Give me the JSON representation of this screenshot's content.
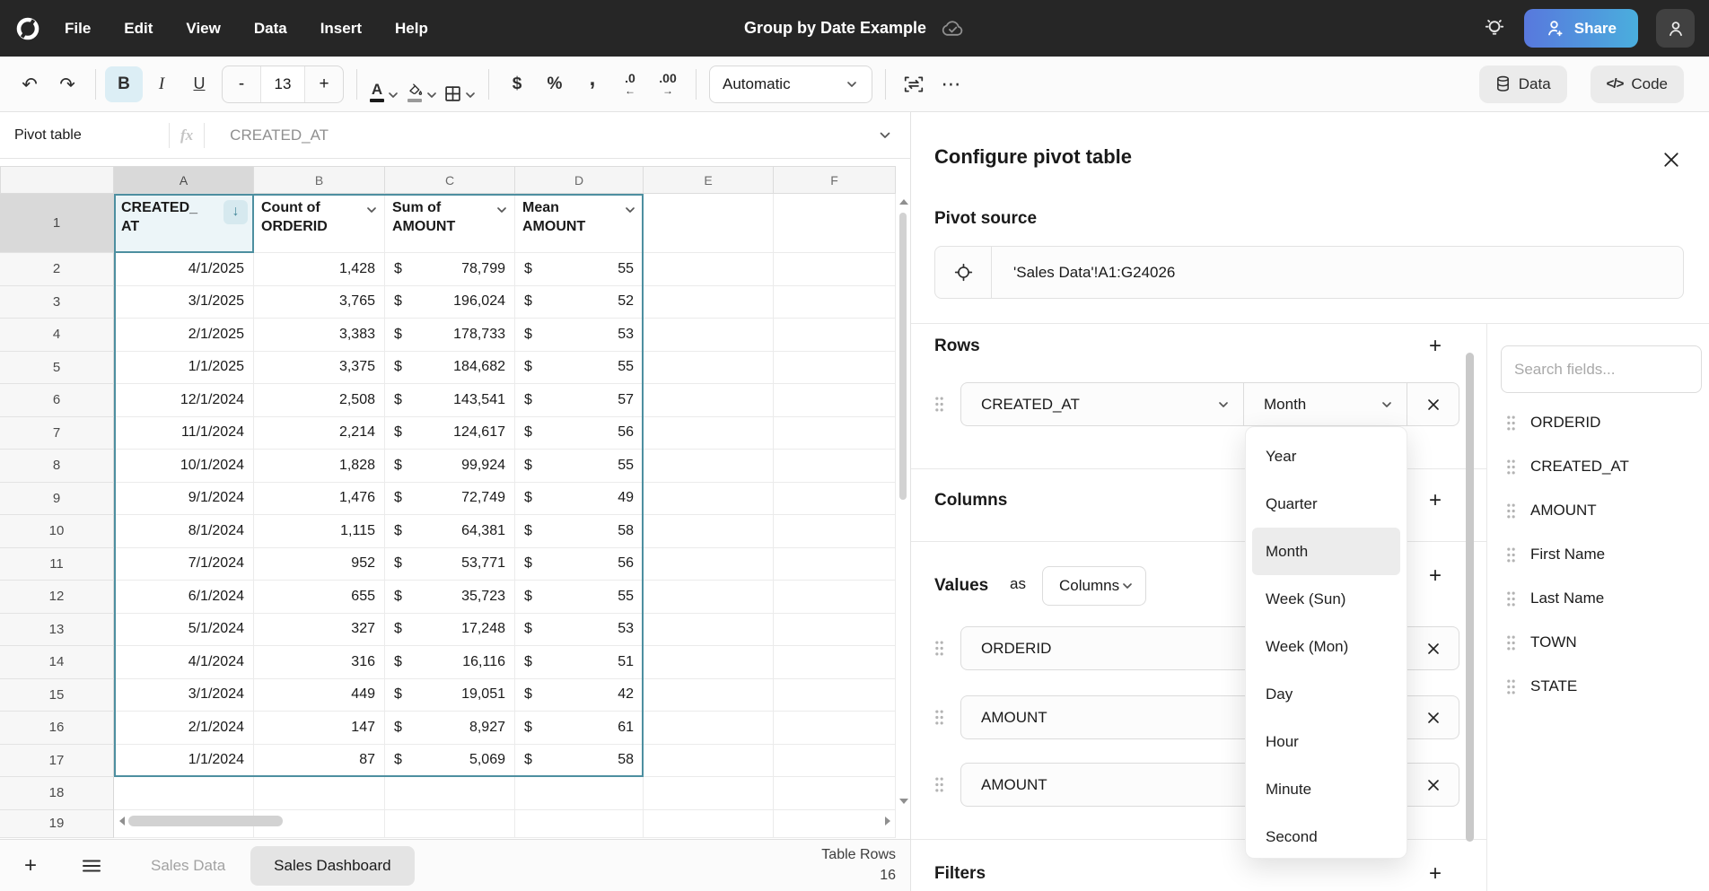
{
  "topbar": {
    "menu": [
      "File",
      "Edit",
      "View",
      "Data",
      "Insert",
      "Help"
    ],
    "title": "Group by Date Example",
    "share_label": "Share"
  },
  "toolbar": {
    "bold": "B",
    "italic": "I",
    "underline": "U",
    "minus": "-",
    "font_size": "13",
    "plus": "+",
    "text_color": "A",
    "currency": "$",
    "percent": "%",
    "comma": ",",
    "dec0": ".0",
    "dec00": ".00",
    "dec_left_arrow": "←",
    "dec_right_arrow": "→",
    "format_select": "Automatic",
    "more": "⋯",
    "data_label": "Data",
    "code_icon": "</>",
    "code_label": "Code",
    "undo": "↶",
    "redo": "↷"
  },
  "formula_bar": {
    "name_box": "Pivot table",
    "fx": "fx",
    "value": "CREATED_AT"
  },
  "grid": {
    "columns": [
      "A",
      "B",
      "C",
      "D",
      "E",
      "F"
    ],
    "row_numbers": [
      "1",
      "2",
      "3",
      "4",
      "5",
      "6",
      "7",
      "8",
      "9",
      "10",
      "11",
      "12",
      "13",
      "14",
      "15",
      "16",
      "17",
      "18",
      "19"
    ],
    "header": {
      "a1": "CREATED_",
      "a2": "AT",
      "b1": "Count of",
      "b2": "ORDERID",
      "c1": "Sum of",
      "c2": "AMOUNT",
      "d1": "Mean",
      "d2": "AMOUNT"
    },
    "sort_arrow": "↓",
    "currency": "$",
    "rows": [
      {
        "date": "4/1/2025",
        "count": "1,428",
        "sum": "78,799",
        "mean": "55"
      },
      {
        "date": "3/1/2025",
        "count": "3,765",
        "sum": "196,024",
        "mean": "52"
      },
      {
        "date": "2/1/2025",
        "count": "3,383",
        "sum": "178,733",
        "mean": "53"
      },
      {
        "date": "1/1/2025",
        "count": "3,375",
        "sum": "184,682",
        "mean": "55"
      },
      {
        "date": "12/1/2024",
        "count": "2,508",
        "sum": "143,541",
        "mean": "57"
      },
      {
        "date": "11/1/2024",
        "count": "2,214",
        "sum": "124,617",
        "mean": "56"
      },
      {
        "date": "10/1/2024",
        "count": "1,828",
        "sum": "99,924",
        "mean": "55"
      },
      {
        "date": "9/1/2024",
        "count": "1,476",
        "sum": "72,749",
        "mean": "49"
      },
      {
        "date": "8/1/2024",
        "count": "1,115",
        "sum": "64,381",
        "mean": "58"
      },
      {
        "date": "7/1/2024",
        "count": "952",
        "sum": "53,771",
        "mean": "56"
      },
      {
        "date": "6/1/2024",
        "count": "655",
        "sum": "35,723",
        "mean": "55"
      },
      {
        "date": "5/1/2024",
        "count": "327",
        "sum": "17,248",
        "mean": "53"
      },
      {
        "date": "4/1/2024",
        "count": "316",
        "sum": "16,116",
        "mean": "51"
      },
      {
        "date": "3/1/2024",
        "count": "449",
        "sum": "19,051",
        "mean": "42"
      },
      {
        "date": "2/1/2024",
        "count": "147",
        "sum": "8,927",
        "mean": "61"
      },
      {
        "date": "1/1/2024",
        "count": "87",
        "sum": "5,069",
        "mean": "58"
      }
    ]
  },
  "sheet_bar": {
    "tabs": [
      {
        "label": "Sales Data"
      },
      {
        "label": "Sales Dashboard"
      }
    ],
    "status_label": "Table Rows",
    "status_value": "16"
  },
  "panel": {
    "title": "Configure pivot table",
    "pivot_source": {
      "label": "Pivot source",
      "value": "'Sales Data'!A1:G24026"
    },
    "rows_section": {
      "label": "Rows",
      "field": "CREATED_AT",
      "interval": "Month"
    },
    "columns_section": {
      "label": "Columns"
    },
    "values_section": {
      "label": "Values",
      "as_label": "as",
      "layout": "Columns",
      "items": [
        "ORDERID",
        "AMOUNT",
        "AMOUNT"
      ]
    },
    "filters_section": {
      "label": "Filters"
    },
    "interval_menu": {
      "items": [
        "Year",
        "Quarter",
        "Month",
        "Week (Sun)",
        "Week (Mon)",
        "Day",
        "Hour",
        "Minute",
        "Second"
      ],
      "selected": "Month"
    },
    "fields": {
      "search_placeholder": "Search fields...",
      "items": [
        "ORDERID",
        "CREATED_AT",
        "AMOUNT",
        "First Name",
        "Last Name",
        "TOWN",
        "STATE"
      ]
    }
  },
  "colors": {
    "accent_teal": "#4d8fa0",
    "selection_fill": "#ecf5f8",
    "topbar_bg": "#262626",
    "share_gradient_start": "#5878dd",
    "share_gradient_end": "#4aaedd",
    "bold_active_bg": "#dceef5",
    "menu_highlight": "#ececec"
  }
}
